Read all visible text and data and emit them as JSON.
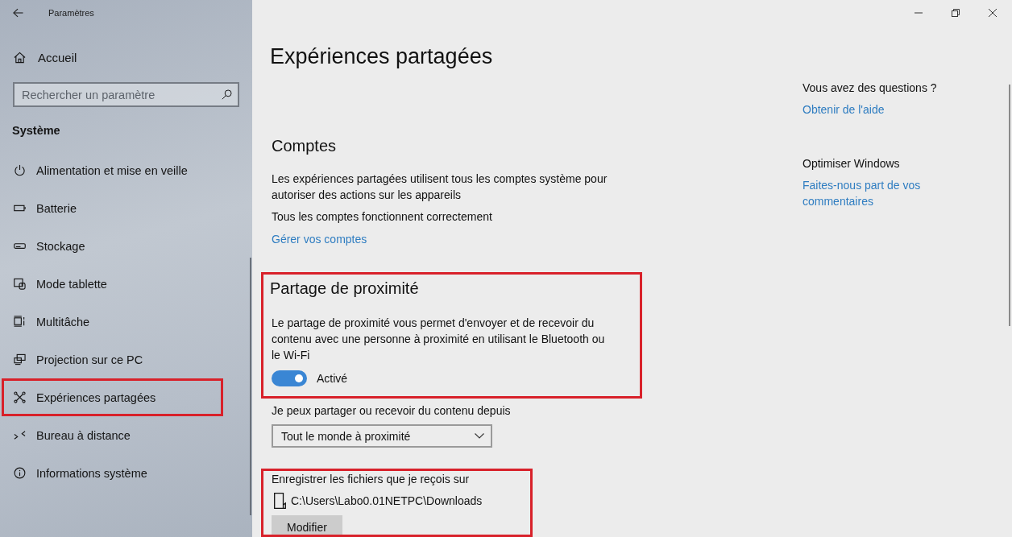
{
  "window": {
    "title": "Paramètres"
  },
  "sidebar": {
    "home": "Accueil",
    "search": {
      "placeholder": "Rechercher un paramètre"
    },
    "section": "Système",
    "items": [
      {
        "label": "Alimentation et mise en veille",
        "highlighted": false
      },
      {
        "label": "Batterie",
        "highlighted": false
      },
      {
        "label": "Stockage",
        "highlighted": false
      },
      {
        "label": "Mode tablette",
        "highlighted": false
      },
      {
        "label": "Multitâche",
        "highlighted": false
      },
      {
        "label": "Projection sur ce PC",
        "highlighted": false
      },
      {
        "label": "Expériences partagées",
        "highlighted": true
      },
      {
        "label": "Bureau à distance",
        "highlighted": false
      },
      {
        "label": "Informations système",
        "highlighted": false
      }
    ]
  },
  "page": {
    "title": "Expériences partagées"
  },
  "accounts": {
    "heading": "Comptes",
    "description": "Les expériences partagées utilisent tous les comptes système pour autoriser des actions sur les appareils",
    "status": "Tous les comptes fonctionnent correctement",
    "link": "Gérer vos comptes"
  },
  "nearby_sharing": {
    "highlighted": true,
    "heading": "Partage de proximité",
    "description": "Le partage de proximité vous permet d'envoyer et de recevoir du contenu avec une personne à proximité en utilisant le Bluetooth ou le Wi-Fi",
    "toggle": {
      "on": true,
      "label": "Activé"
    }
  },
  "share_from": {
    "label": "Je peux partager ou recevoir du contenu depuis",
    "dropdown": {
      "value": "Tout le monde à proximité"
    }
  },
  "save_location": {
    "highlighted": true,
    "label": "Enregistrer les fichiers que je reçois sur",
    "path": "C:\\Users\\Labo0.01NETPC\\Downloads",
    "button": "Modifier"
  },
  "help": [
    {
      "heading": "Vous avez des questions ?",
      "link": "Obtenir de l'aide"
    },
    {
      "heading": "Optimiser Windows",
      "link": "Faites-nous part de vos commentaires"
    }
  ]
}
